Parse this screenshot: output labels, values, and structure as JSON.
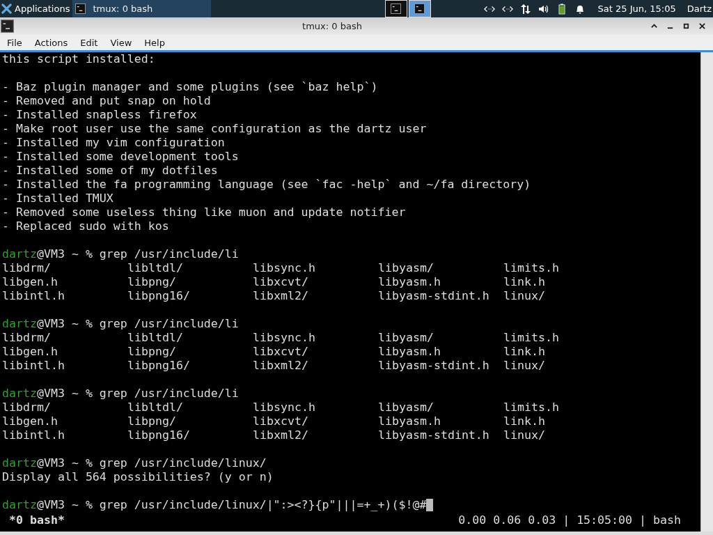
{
  "taskbar": {
    "apps_menu": "Applications",
    "tasks": [
      {
        "title": "tmux: 0 bash",
        "selected": true
      }
    ],
    "launchers": [
      {
        "selected": false
      },
      {
        "selected": true
      }
    ],
    "clock": "Sat 25 Jun, 15:05",
    "user": "Dartz"
  },
  "window": {
    "title": "tmux: 0 bash"
  },
  "menu": [
    "File",
    "Actions",
    "Edit",
    "View",
    "Help"
  ],
  "terminal": {
    "lines": [
      {
        "kind": "text",
        "text": "this script installed:"
      },
      {
        "kind": "blank"
      },
      {
        "kind": "text",
        "text": "- Baz plugin manager and some plugins (see `baz help`)"
      },
      {
        "kind": "text",
        "text": "- Removed and put snap on hold"
      },
      {
        "kind": "text",
        "text": "- Installed snapless firefox"
      },
      {
        "kind": "text",
        "text": "- Make root user use the same configuration as the dartz user"
      },
      {
        "kind": "text",
        "text": "- Installed my vim configuration"
      },
      {
        "kind": "text",
        "text": "- Installed some development tools"
      },
      {
        "kind": "text",
        "text": "- Installed some of my dotfiles"
      },
      {
        "kind": "text",
        "text": "- Installed the fa programming language (see `fac -help` and ~/fa directory)"
      },
      {
        "kind": "text",
        "text": "- Installed TMUX"
      },
      {
        "kind": "text",
        "text": "- Removed some useless thing like muon and update notifier"
      },
      {
        "kind": "text",
        "text": "- Replaced sudo with kos"
      },
      {
        "kind": "blank"
      },
      {
        "kind": "prompt",
        "user": "dartz",
        "text": "@VM3 ~ % grep /usr/include/li"
      },
      {
        "kind": "columns",
        "cells": [
          "libdrm/",
          "libltdl/",
          "libsync.h",
          "libyasm/",
          "limits.h"
        ]
      },
      {
        "kind": "columns",
        "cells": [
          "libgen.h",
          "libpng/",
          "libxcvt/",
          "libyasm.h",
          "link.h"
        ]
      },
      {
        "kind": "columns",
        "cells": [
          "libintl.h",
          "libpng16/",
          "libxml2/",
          "libyasm-stdint.h",
          "linux/"
        ]
      },
      {
        "kind": "blank"
      },
      {
        "kind": "prompt",
        "user": "dartz",
        "text": "@VM3 ~ % grep /usr/include/li"
      },
      {
        "kind": "columns",
        "cells": [
          "libdrm/",
          "libltdl/",
          "libsync.h",
          "libyasm/",
          "limits.h"
        ]
      },
      {
        "kind": "columns",
        "cells": [
          "libgen.h",
          "libpng/",
          "libxcvt/",
          "libyasm.h",
          "link.h"
        ]
      },
      {
        "kind": "columns",
        "cells": [
          "libintl.h",
          "libpng16/",
          "libxml2/",
          "libyasm-stdint.h",
          "linux/"
        ]
      },
      {
        "kind": "blank"
      },
      {
        "kind": "prompt",
        "user": "dartz",
        "text": "@VM3 ~ % grep /usr/include/li"
      },
      {
        "kind": "columns",
        "cells": [
          "libdrm/",
          "libltdl/",
          "libsync.h",
          "libyasm/",
          "limits.h"
        ]
      },
      {
        "kind": "columns",
        "cells": [
          "libgen.h",
          "libpng/",
          "libxcvt/",
          "libyasm.h",
          "link.h"
        ]
      },
      {
        "kind": "columns",
        "cells": [
          "libintl.h",
          "libpng16/",
          "libxml2/",
          "libyasm-stdint.h",
          "linux/"
        ]
      },
      {
        "kind": "blank"
      },
      {
        "kind": "prompt",
        "user": "dartz",
        "text": "@VM3 ~ % grep /usr/include/linux/"
      },
      {
        "kind": "text",
        "text": "Display all 564 possibilities? (y or n)"
      },
      {
        "kind": "blank"
      },
      {
        "kind": "prompt",
        "user": "dartz",
        "text": "@VM3 ~ % grep /usr/include/linux/|\":><?}{p\"|||=+_+)($!@#",
        "cursor": true
      }
    ],
    "status": {
      "left": "*0 bash*",
      "right": "0.00 0.06 0.03 | 15:05:00 | bash"
    }
  }
}
